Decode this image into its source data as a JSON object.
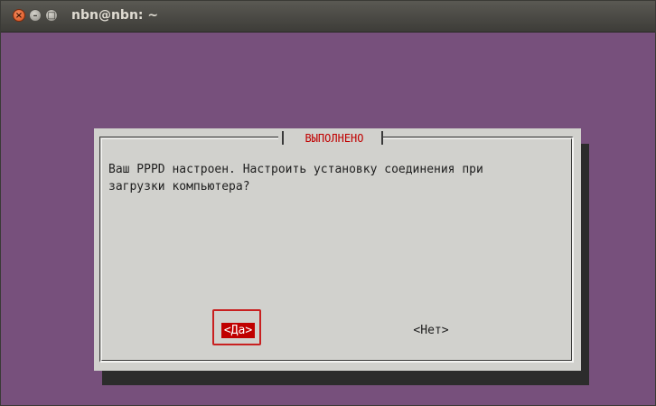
{
  "window": {
    "title": "nbn@nbn: ~",
    "close_glyph": "×",
    "minimize_glyph": "–",
    "maximize_glyph": "□"
  },
  "colors": {
    "terminal_background": "#77507c",
    "dialog_background": "#d1d1cd",
    "accent_red": "#c00000",
    "highlight_outline": "#c82020"
  },
  "dialog": {
    "title": "ВЫПОЛНЕНО",
    "message": "Ваш PPPD настроен. Настроить установку соединения при\nзагрузки компьютера?",
    "buttons": {
      "yes_label": "<Да>",
      "no_label": "<Нет>"
    },
    "selected_button": "yes"
  }
}
